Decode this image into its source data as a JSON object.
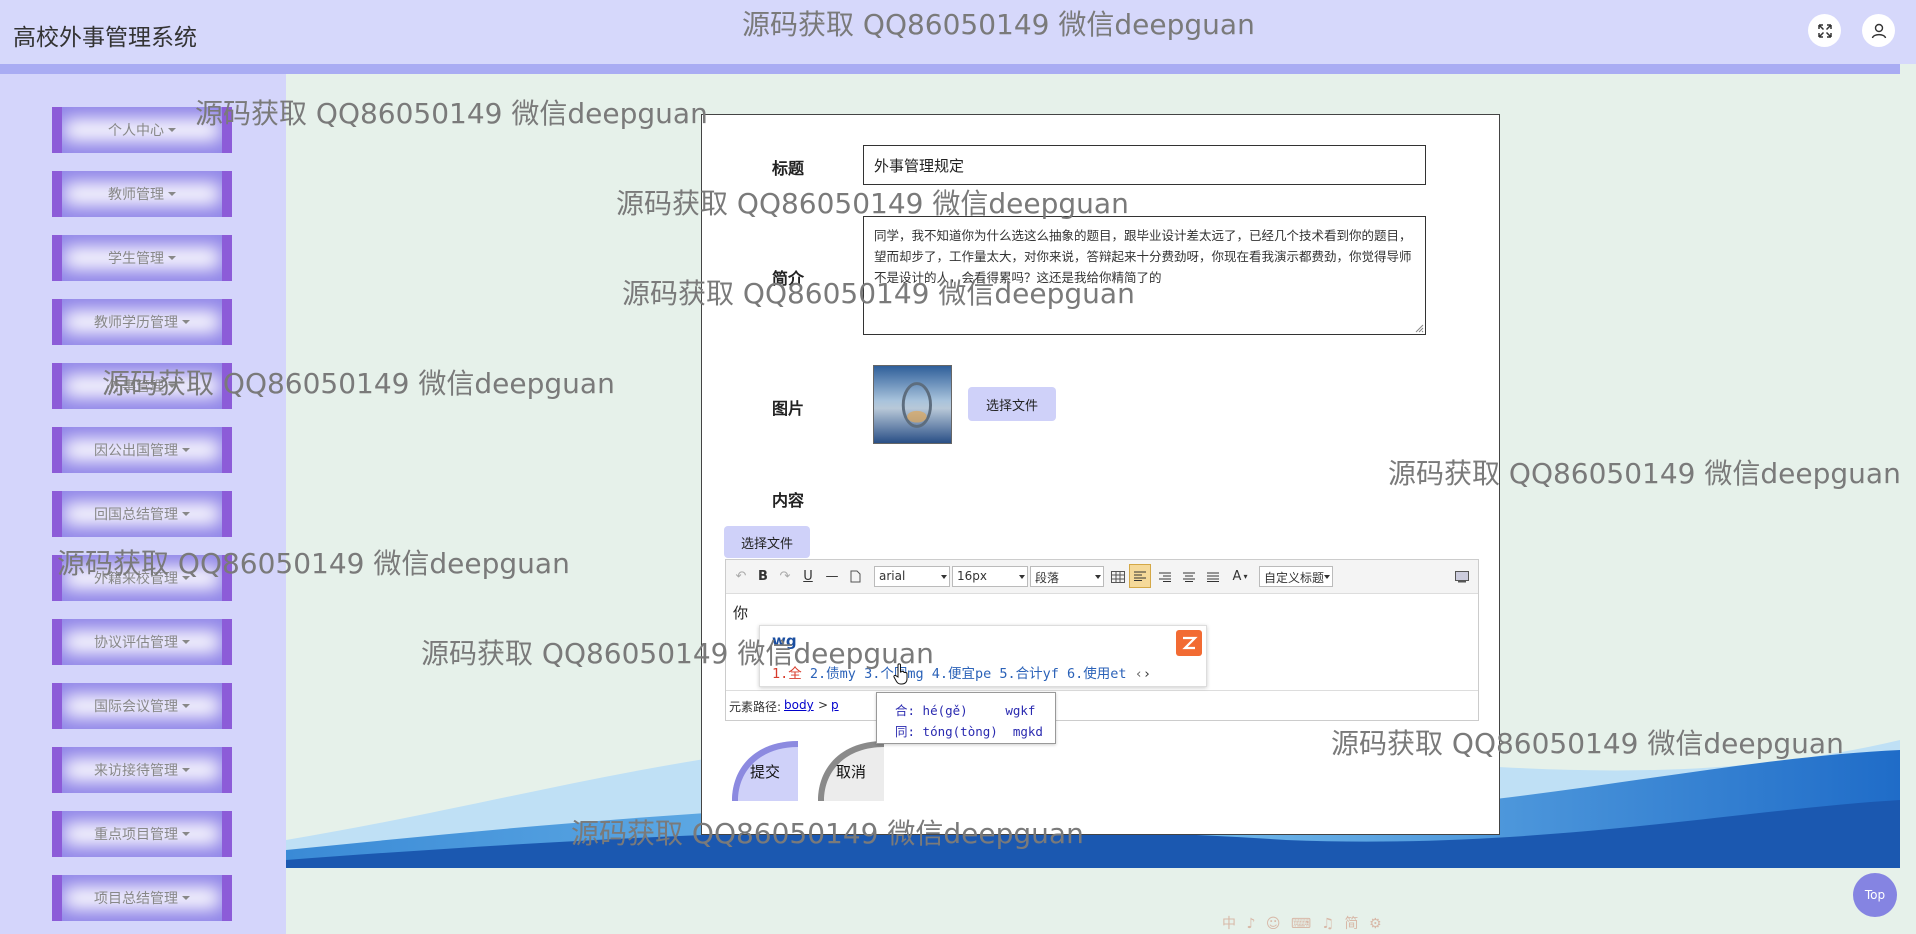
{
  "header": {
    "app_title": "高校外事管理系统"
  },
  "sidebar": {
    "items": [
      {
        "label": "个人中心"
      },
      {
        "label": "教师管理"
      },
      {
        "label": "学生管理"
      },
      {
        "label": "教师学历管理"
      },
      {
        "label": "外事管理"
      },
      {
        "label": "因公出国管理"
      },
      {
        "label": "回国总结管理"
      },
      {
        "label": "外籍来校管理"
      },
      {
        "label": "协议评估管理"
      },
      {
        "label": "国际会议管理"
      },
      {
        "label": "来访接待管理"
      },
      {
        "label": "重点项目管理"
      },
      {
        "label": "项目总结管理"
      }
    ]
  },
  "form": {
    "title_label": "标题",
    "title_value": "外事管理规定",
    "intro_label": "简介",
    "intro_value": "同学，我不知道你为什么选这么抽象的题目，跟毕业设计差太远了，已经几个技术看到你的题目，望而却步了，工作量太大，对你来说，答辩起来十分费劲呀，你现在看我演示都费劲，你觉得导师不是设计的人，会看得累吗？这还是我给你精简了的",
    "image_label": "图片",
    "choose_file_label": "选择文件",
    "content_label": "内容",
    "content_choose_file_label": "选择文件",
    "submit_label": "提交",
    "cancel_label": "取消"
  },
  "editor": {
    "font_family": "arial",
    "font_size": "16px",
    "paragraph": "段落",
    "custom_title": "自定义标题",
    "body_text": "你",
    "path_label": "元素路径:",
    "path_body": "body",
    "path_sep": ">",
    "path_p": "p"
  },
  "ime": {
    "typed": "wg",
    "candidates": [
      {
        "label": "1.全"
      },
      {
        "label": "2.债my"
      },
      {
        "label": "3.个同mg"
      },
      {
        "label": "4.便宜pe"
      },
      {
        "label": "5.合计yf"
      },
      {
        "label": "6.使用et"
      }
    ],
    "hint_line1": "合: hé(gě)     wgkf",
    "hint_line2": "同: tóng(tòng)  mgkd"
  },
  "watermark": "源码获取 QQ86050149 微信deepguan",
  "top_button": "Top",
  "tray_text": "中 ♪ ☺ ⌨ ♫ 简 ⚙"
}
